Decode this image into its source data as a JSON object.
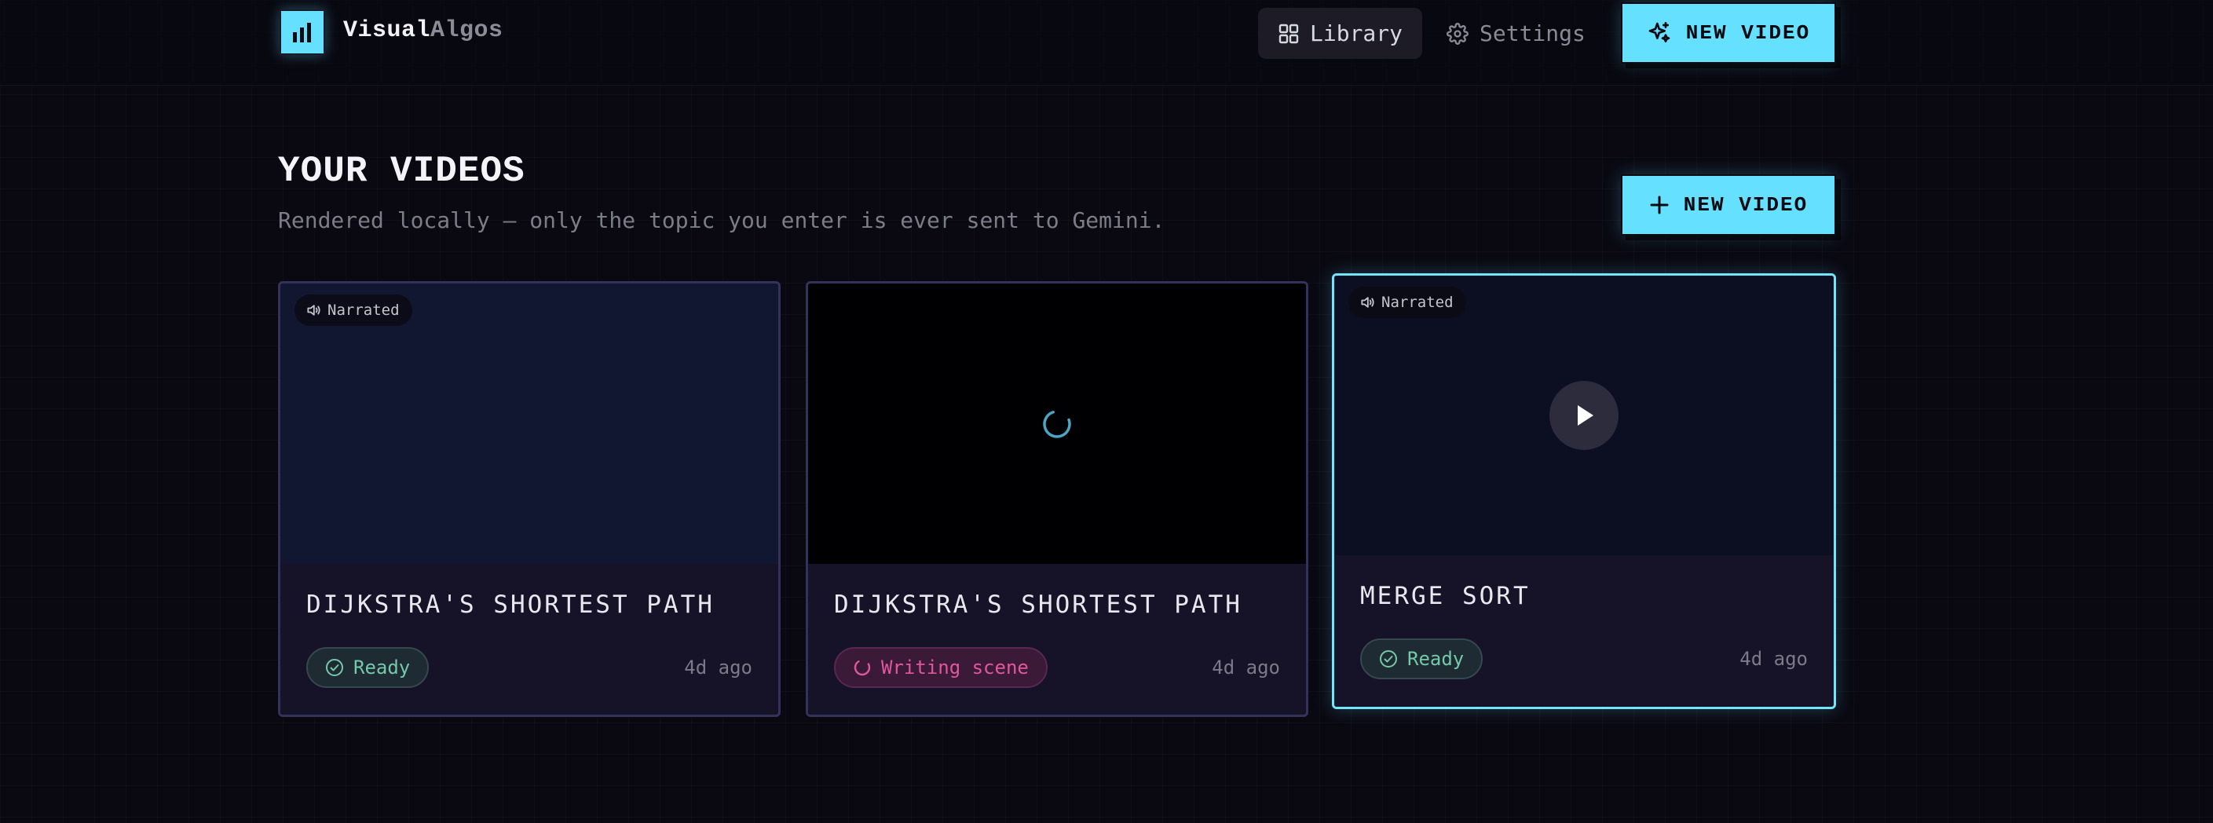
{
  "brand": {
    "part1": "Visual",
    "part2": "Algos",
    "logo_icon": "bar-chart-icon"
  },
  "nav": {
    "library_label": "Library",
    "settings_label": "Settings",
    "new_video_label": "NEW VIDEO"
  },
  "header": {
    "title": "YOUR VIDEOS",
    "subtitle": "Rendered locally — only the topic you enter is ever sent to Gemini.",
    "new_video_label": "NEW VIDEO"
  },
  "videos": [
    {
      "title": "DIJKSTRA'S SHORTEST PATH",
      "badge": "Narrated",
      "status": "Ready",
      "ago": "4d ago"
    },
    {
      "title": "DIJKSTRA'S SHORTEST PATH",
      "status": "Writing scene",
      "ago": "4d ago"
    },
    {
      "title": "MERGE SORT",
      "badge": "Narrated",
      "status": "Ready",
      "ago": "4d ago"
    }
  ],
  "colors": {
    "accent": "#66e0ff",
    "background": "#0a0912",
    "ready": "#73c9a8",
    "writing": "#e0579d"
  }
}
